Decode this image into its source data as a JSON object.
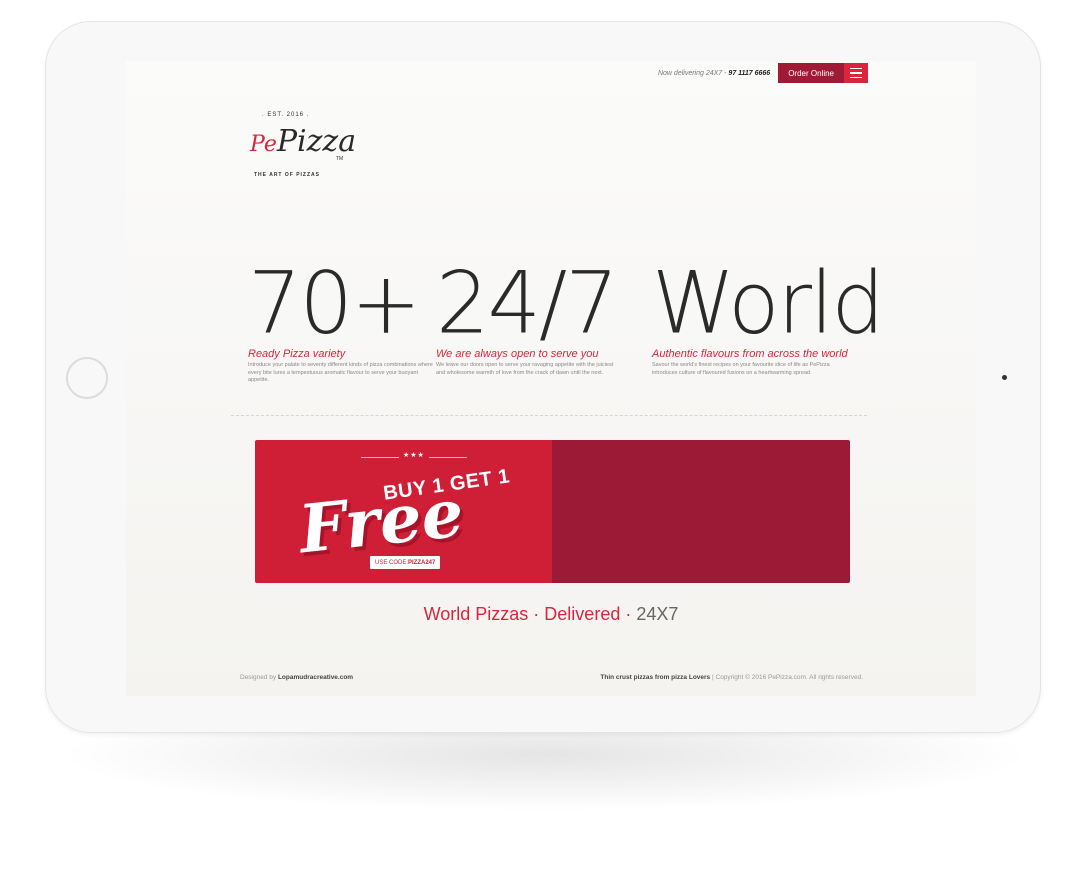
{
  "header": {
    "tagline_prefix": "Now delivering 24X7 - ",
    "phone": "97 1117 6666",
    "order_label": "Order Online",
    "menu_icon": "hamburger-menu-icon"
  },
  "logo": {
    "est": ". EST. 2016 .",
    "script_pe": "Pe",
    "script_pizza": "Pizza",
    "tm": "TM",
    "subtitle": "THE ART OF PIZZAS"
  },
  "stats": [
    {
      "big": "70+",
      "heading": "Ready Pizza variety",
      "description": "Introduce your palate to seventy different kinds of pizza combinations where every bite lures a tempestuous aromatic flavour to serve your buoyant appetite."
    },
    {
      "big": "24/7",
      "heading": "We are always open to serve you",
      "description": "We leave our doors open to serve your ravaging appetite with the juiciest and wholesome warmth of love from the crack of dawn until the next."
    },
    {
      "big": "World",
      "heading": "Authentic flavours from across the world",
      "description": "Savour the world's finest recipes on your favourite slice of life as PePizza introduces culture of flavoured fusions on a heartwarming spread."
    }
  ],
  "banner": {
    "stars": "★★★",
    "headline": "BUY 1 GET 1",
    "free": "Free",
    "code_label": "USE CODE: ",
    "code_value": "PIZZA247",
    "color_left": "#cf1f37",
    "color_right": "#9c1a35"
  },
  "tagline_bottom": {
    "part1": "World Pizzas · Delivered · ",
    "part2": "24X7"
  },
  "footer": {
    "designed_prefix": "Designed by ",
    "designer": "Lopamudracreative.com",
    "slogan": "Thin crust pizzas from pizza Lovers",
    "separator": "  |  ",
    "copyright": "Copyright © 2016 PePizza.com. All rights reserved."
  },
  "colors": {
    "accent": "#d7263d",
    "dark_accent": "#9f1a35"
  }
}
